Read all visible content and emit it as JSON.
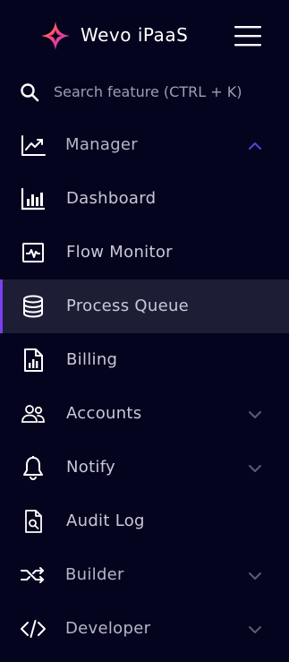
{
  "header": {
    "app_title": "Wevo iPaaS",
    "logo_icon": "star-logo-icon",
    "menu_icon": "hamburger-menu-icon"
  },
  "search": {
    "placeholder": "Search feature (CTRL + K)",
    "icon": "search-icon"
  },
  "nav": {
    "items": [
      {
        "label": "Manager",
        "icon": "trending-chart-icon",
        "chevron": "chevron-up-icon",
        "expanded": true
      },
      {
        "label": "Dashboard",
        "icon": "bar-chart-icon"
      },
      {
        "label": "Flow Monitor",
        "icon": "pulse-monitor-icon"
      },
      {
        "label": "Process Queue",
        "icon": "database-icon",
        "active": true
      },
      {
        "label": "Billing",
        "icon": "report-document-icon"
      },
      {
        "label": "Accounts",
        "icon": "users-icon",
        "chevron": "chevron-down-icon"
      },
      {
        "label": "Notify",
        "icon": "bell-icon",
        "chevron": "chevron-down-icon"
      },
      {
        "label": "Audit Log",
        "icon": "document-search-icon"
      },
      {
        "label": "Builder",
        "icon": "shuffle-icon",
        "chevron": "chevron-down-icon"
      },
      {
        "label": "Developer",
        "icon": "code-icon",
        "chevron": "chevron-down-icon"
      }
    ]
  },
  "colors": {
    "background": "#05041e",
    "active_background": "#1e1d36",
    "active_indicator": "#7b3ff2",
    "text": "#c9c8d8",
    "title": "#ffffff"
  }
}
